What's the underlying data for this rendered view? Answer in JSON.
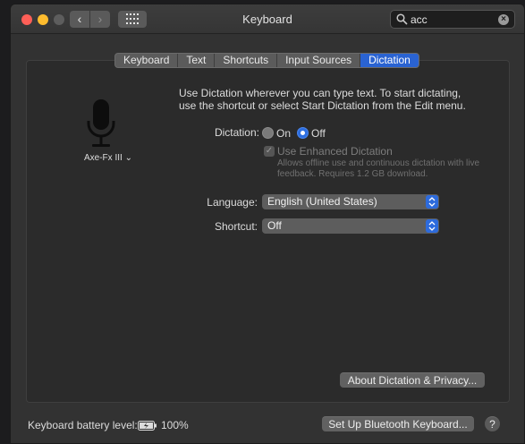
{
  "window": {
    "title": "Keyboard",
    "search": {
      "value": "acc",
      "placeholder": "Search"
    }
  },
  "toolbar": {
    "back_glyph": "‹",
    "forward_glyph": "›"
  },
  "tabs": [
    {
      "label": "Keyboard",
      "active": false
    },
    {
      "label": "Text",
      "active": false
    },
    {
      "label": "Shortcuts",
      "active": false
    },
    {
      "label": "Input Sources",
      "active": false
    },
    {
      "label": "Dictation",
      "active": true
    }
  ],
  "dictation": {
    "intro": "Use Dictation wherever you can type text. To start dictating, use the shortcut or select Start Dictation from the Edit menu.",
    "device_name": "Axe-Fx III",
    "label": "Dictation:",
    "option_on": "On",
    "option_off": "Off",
    "selected": "Off",
    "enhanced_label": "Use Enhanced Dictation",
    "enhanced_checked": true,
    "enhanced_enabled": false,
    "enhanced_note": "Allows offline use and continuous dictation with live feedback. Requires 1.2 GB download.",
    "language_label": "Language:",
    "language_value": "English (United States)",
    "shortcut_label": "Shortcut:",
    "shortcut_value": "Off",
    "about_button": "About Dictation & Privacy..."
  },
  "footer": {
    "battery_label": "Keyboard battery level:",
    "battery_percent": "100%",
    "setup_button": "Set Up Bluetooth Keyboard...",
    "help": "?"
  },
  "colors": {
    "accent": "#2a63d2",
    "window_bg": "#323232",
    "pane_bg": "#2b2b2b",
    "close": "#fe5f57",
    "minimize": "#febc2e"
  },
  "icons": [
    "back-arrow",
    "forward-arrow",
    "grid",
    "search",
    "clear",
    "microphone",
    "chevron-down",
    "battery-charging",
    "select-arrows",
    "help"
  ]
}
